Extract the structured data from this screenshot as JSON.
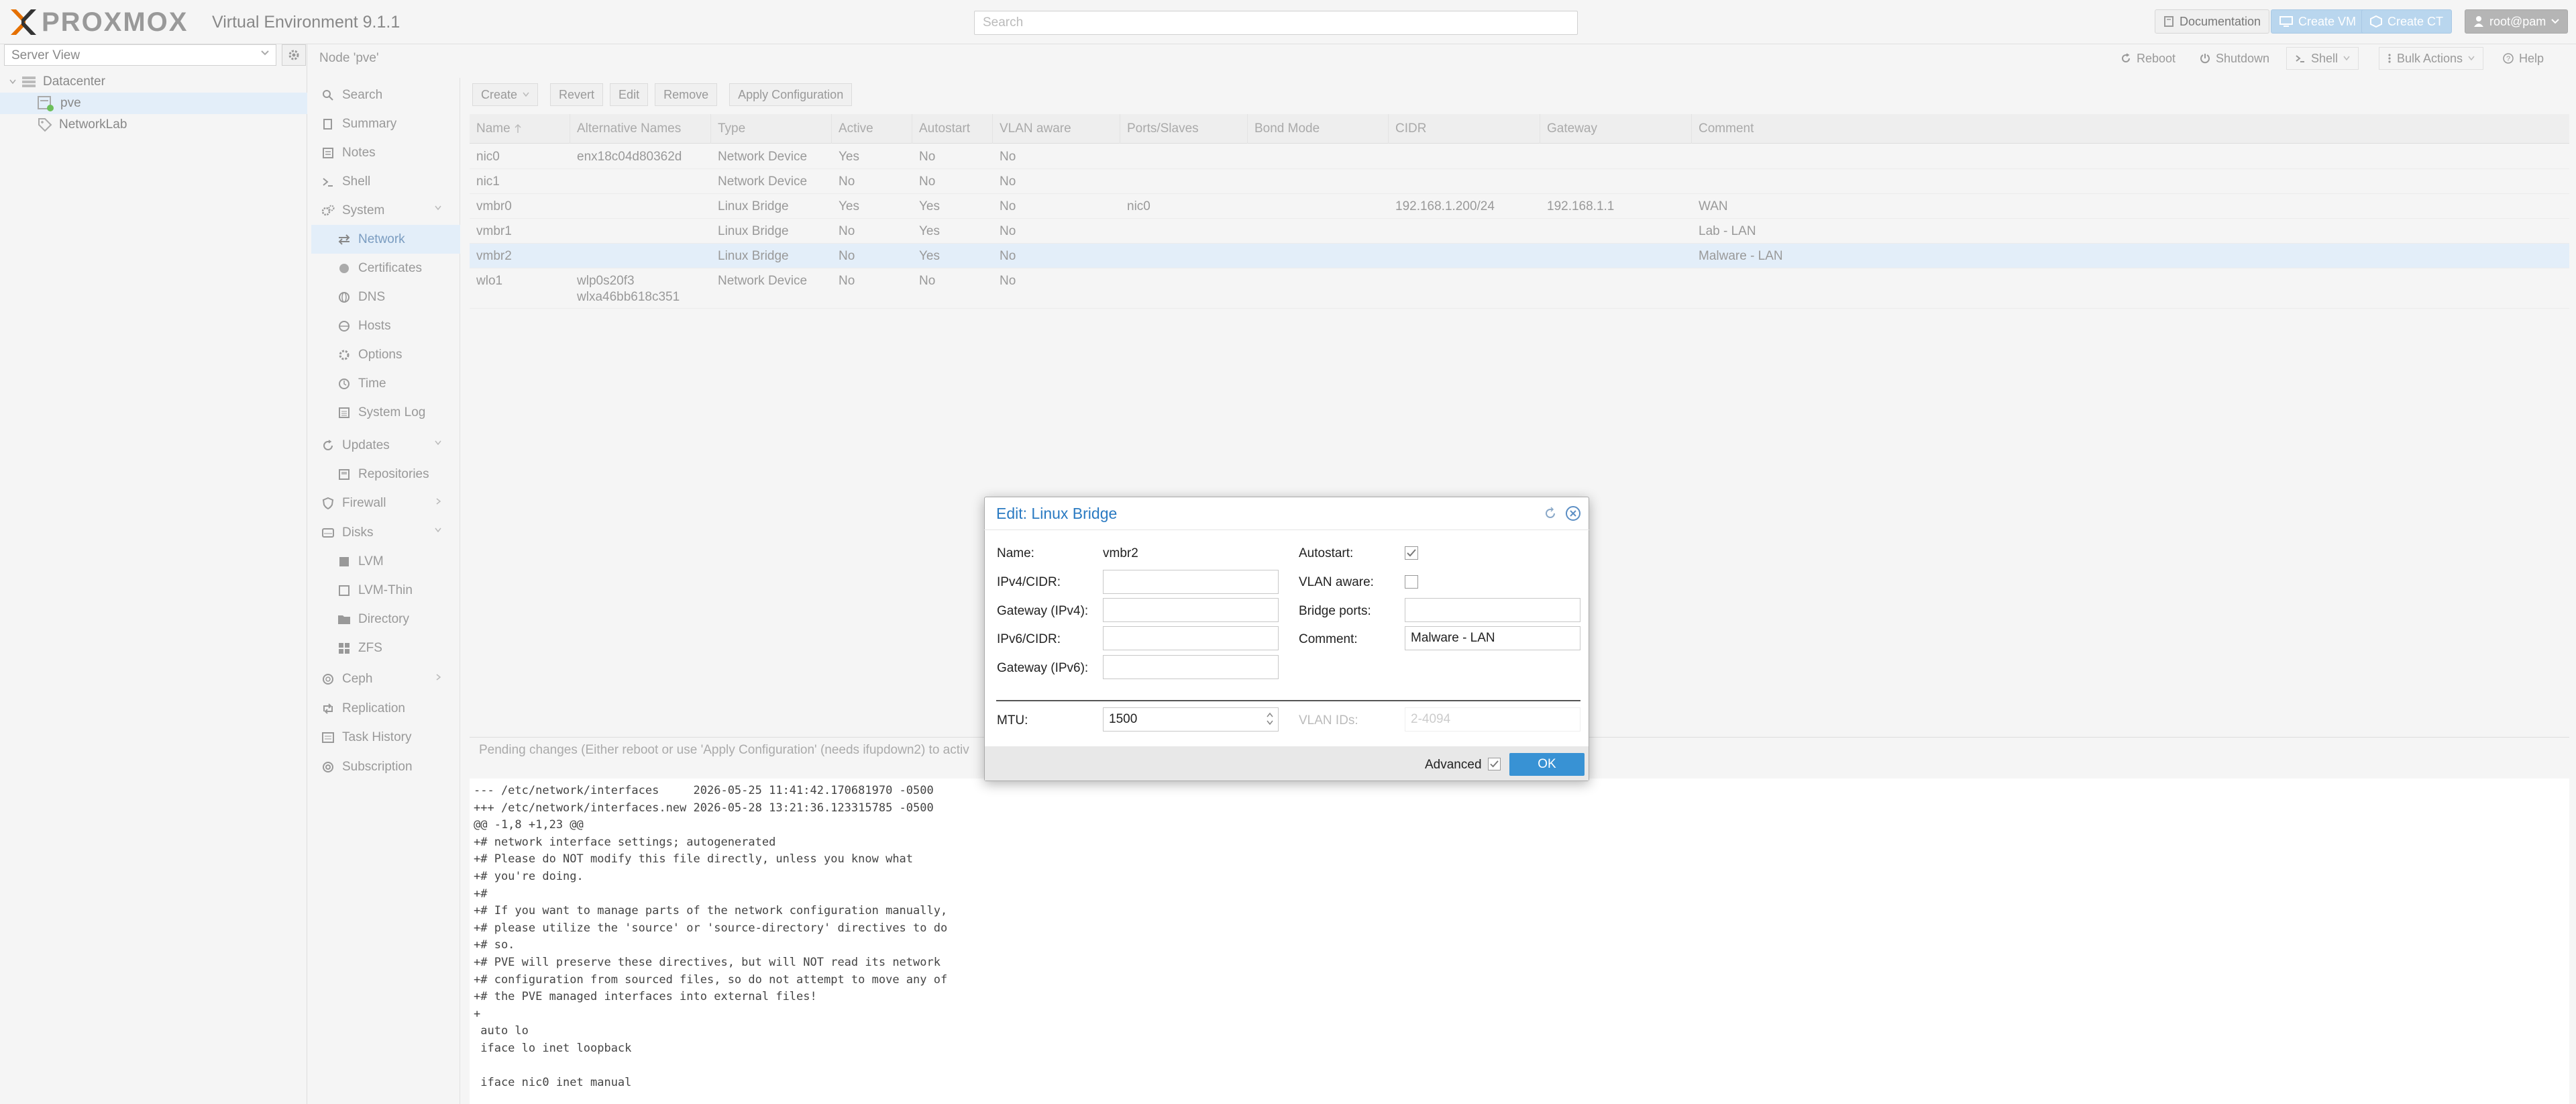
{
  "header": {
    "logo_text": "PROXMOX",
    "version": "Virtual Environment 9.1.1",
    "search_placeholder": "Search",
    "documentation": "Documentation",
    "create_vm": "Create VM",
    "create_ct": "Create CT",
    "user": "root@pam"
  },
  "tree": {
    "view_label": "Server View",
    "items": [
      {
        "label": "Datacenter"
      },
      {
        "label": "pve"
      },
      {
        "label": "NetworkLab"
      }
    ]
  },
  "node": {
    "title": "Node 'pve'",
    "buttons": {
      "reboot": "Reboot",
      "shutdown": "Shutdown",
      "shell": "Shell",
      "bulk": "Bulk Actions",
      "help": "Help"
    }
  },
  "menu": {
    "search": "Search",
    "summary": "Summary",
    "notes": "Notes",
    "shell": "Shell",
    "system": "System",
    "network": "Network",
    "certificates": "Certificates",
    "dns": "DNS",
    "hosts": "Hosts",
    "options": "Options",
    "time": "Time",
    "syslog": "System Log",
    "updates": "Updates",
    "repositories": "Repositories",
    "firewall": "Firewall",
    "disks": "Disks",
    "lvm": "LVM",
    "lvmthin": "LVM-Thin",
    "directory": "Directory",
    "zfs": "ZFS",
    "ceph": "Ceph",
    "replication": "Replication",
    "taskhistory": "Task History",
    "subscription": "Subscription"
  },
  "toolbar": {
    "create": "Create",
    "revert": "Revert",
    "edit": "Edit",
    "remove": "Remove",
    "apply": "Apply Configuration"
  },
  "grid": {
    "columns": [
      "Name",
      "Alternative Names",
      "Type",
      "Active",
      "Autostart",
      "VLAN aware",
      "Ports/Slaves",
      "Bond Mode",
      "CIDR",
      "Gateway",
      "Comment"
    ],
    "rows": [
      {
        "name": "nic0",
        "alt": "enx18c04d80362d",
        "alt2": "",
        "type": "Network Device",
        "active": "Yes",
        "autostart": "No",
        "vlan": "No",
        "ports": "",
        "bond": "",
        "cidr": "",
        "gateway": "",
        "comment": ""
      },
      {
        "name": "nic1",
        "alt": "",
        "alt2": "",
        "type": "Network Device",
        "active": "No",
        "autostart": "No",
        "vlan": "No",
        "ports": "",
        "bond": "",
        "cidr": "",
        "gateway": "",
        "comment": ""
      },
      {
        "name": "vmbr0",
        "alt": "",
        "alt2": "",
        "type": "Linux Bridge",
        "active": "Yes",
        "autostart": "Yes",
        "vlan": "No",
        "ports": "nic0",
        "bond": "",
        "cidr": "192.168.1.200/24",
        "gateway": "192.168.1.1",
        "comment": "WAN"
      },
      {
        "name": "vmbr1",
        "alt": "",
        "alt2": "",
        "type": "Linux Bridge",
        "active": "No",
        "autostart": "Yes",
        "vlan": "No",
        "ports": "",
        "bond": "",
        "cidr": "",
        "gateway": "",
        "comment": "Lab - LAN"
      },
      {
        "name": "vmbr2",
        "alt": "",
        "alt2": "",
        "type": "Linux Bridge",
        "active": "No",
        "autostart": "Yes",
        "vlan": "No",
        "ports": "",
        "bond": "",
        "cidr": "",
        "gateway": "",
        "comment": "Malware - LAN"
      },
      {
        "name": "wlo1",
        "alt": "wlp0s20f3",
        "alt2": "wlxa46bb618c351",
        "type": "Network Device",
        "active": "No",
        "autostart": "No",
        "vlan": "No",
        "ports": "",
        "bond": "",
        "cidr": "",
        "gateway": "",
        "comment": ""
      }
    ]
  },
  "pending": {
    "header": "Pending changes (Either reboot or use 'Apply Configuration' (needs ifupdown2) to activ",
    "lines": [
      "--- /etc/network/interfaces\t2026-05-25 11:41:42.170681970 -0500",
      "+++ /etc/network/interfaces.new 2026-05-28 13:21:36.123315785 -0500",
      "@@ -1,8 +1,23 @@",
      "+# network interface settings; autogenerated",
      "+# Please do NOT modify this file directly, unless you know what",
      "+# you're doing.",
      "+#",
      "+# If you want to manage parts of the network configuration manually,",
      "+# please utilize the 'source' or 'source-directory' directives to do",
      "+# so.",
      "+# PVE will preserve these directives, but will NOT read its network",
      "+# configuration from sourced files, so do not attempt to move any of",
      "+# the PVE managed interfaces into external files!",
      "+",
      " auto lo",
      " iface lo inet loopback",
      "",
      " iface nic0 inet manual"
    ]
  },
  "dialog": {
    "title": "Edit: Linux Bridge",
    "name_label": "Name:",
    "name_value": "vmbr2",
    "ipv4_label": "IPv4/CIDR:",
    "gw4_label": "Gateway (IPv4):",
    "ipv6_label": "IPv6/CIDR:",
    "gw6_label": "Gateway (IPv6):",
    "autostart_label": "Autostart:",
    "vlan_label": "VLAN aware:",
    "bridge_ports_label": "Bridge ports:",
    "comment_label": "Comment:",
    "comment_value": "Malware - LAN",
    "mtu_label": "MTU:",
    "mtu_value": "1500",
    "vlan_ids_label": "VLAN IDs:",
    "vlan_ids_placeholder": "2-4094",
    "advanced_label": "Advanced",
    "ok_label": "OK"
  }
}
